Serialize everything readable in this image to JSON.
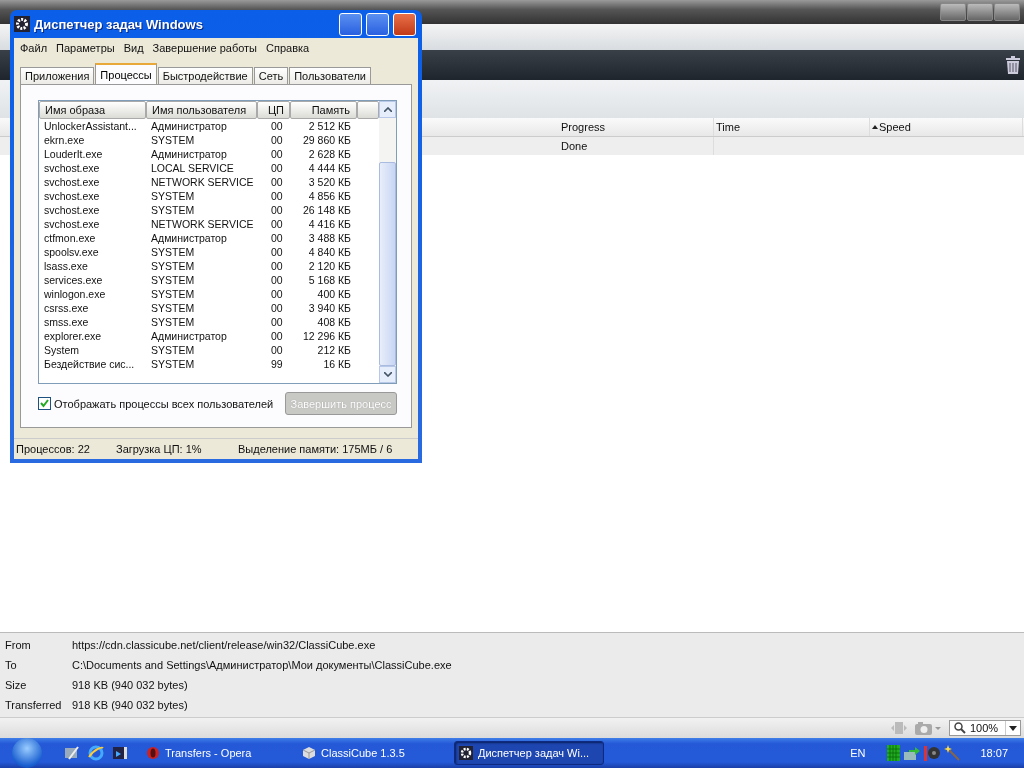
{
  "transfers": {
    "columns": [
      {
        "label": "Progress",
        "sorted": false
      },
      {
        "label": "Time",
        "sorted": false
      },
      {
        "label": "Speed",
        "sorted": true
      }
    ],
    "rows": [
      {
        "progress": "Done"
      }
    ]
  },
  "details": [
    {
      "label": "From",
      "value": "https://cdn.classicube.net/client/release/win32/ClassiCube.exe"
    },
    {
      "label": "To",
      "value": "C:\\Documents and Settings\\Администратор\\Мои документы\\ClassiCube.exe"
    },
    {
      "label": "Size",
      "value": "918 KB (940 032 bytes)"
    },
    {
      "label": "Transferred",
      "value": "918 KB (940 032 bytes)"
    }
  ],
  "zoom": "100%",
  "task_manager": {
    "title": "Диспетчер задач Windows",
    "menu": [
      "Файл",
      "Параметры",
      "Вид",
      "Завершение работы",
      "Справка"
    ],
    "tabs": [
      {
        "label": "Приложения",
        "selected": false
      },
      {
        "label": "Процессы",
        "selected": true
      },
      {
        "label": "Быстродействие",
        "selected": false
      },
      {
        "label": "Сеть",
        "selected": false
      },
      {
        "label": "Пользователи",
        "selected": false
      }
    ],
    "columns": [
      "Имя образа",
      "Имя пользователя",
      "ЦП",
      "Память"
    ],
    "processes": [
      {
        "name": "UnlockerAssistant...",
        "user": "Администратор",
        "cpu": "00",
        "memory": "2 512 КБ"
      },
      {
        "name": "ekrn.exe",
        "user": "SYSTEM",
        "cpu": "00",
        "memory": "29 860 КБ"
      },
      {
        "name": "LouderIt.exe",
        "user": "Администратор",
        "cpu": "00",
        "memory": "2 628 КБ"
      },
      {
        "name": "svchost.exe",
        "user": "LOCAL SERVICE",
        "cpu": "00",
        "memory": "4 444 КБ"
      },
      {
        "name": "svchost.exe",
        "user": "NETWORK SERVICE",
        "cpu": "00",
        "memory": "3 520 КБ"
      },
      {
        "name": "svchost.exe",
        "user": "SYSTEM",
        "cpu": "00",
        "memory": "4 856 КБ"
      },
      {
        "name": "svchost.exe",
        "user": "SYSTEM",
        "cpu": "00",
        "memory": "26 148 КБ"
      },
      {
        "name": "svchost.exe",
        "user": "NETWORK SERVICE",
        "cpu": "00",
        "memory": "4 416 КБ"
      },
      {
        "name": "ctfmon.exe",
        "user": "Администратор",
        "cpu": "00",
        "memory": "3 488 КБ"
      },
      {
        "name": "spoolsv.exe",
        "user": "SYSTEM",
        "cpu": "00",
        "memory": "4 840 КБ"
      },
      {
        "name": "lsass.exe",
        "user": "SYSTEM",
        "cpu": "00",
        "memory": "2 120 КБ"
      },
      {
        "name": "services.exe",
        "user": "SYSTEM",
        "cpu": "00",
        "memory": "5 168 КБ"
      },
      {
        "name": "winlogon.exe",
        "user": "SYSTEM",
        "cpu": "00",
        "memory": "400 КБ"
      },
      {
        "name": "csrss.exe",
        "user": "SYSTEM",
        "cpu": "00",
        "memory": "3 940 КБ"
      },
      {
        "name": "smss.exe",
        "user": "SYSTEM",
        "cpu": "00",
        "memory": "408 КБ"
      },
      {
        "name": "explorer.exe",
        "user": "Администратор",
        "cpu": "00",
        "memory": "12 296 КБ"
      },
      {
        "name": "System",
        "user": "SYSTEM",
        "cpu": "00",
        "memory": "212 КБ"
      },
      {
        "name": "Бездействие сис...",
        "user": "SYSTEM",
        "cpu": "99",
        "memory": "16 КБ"
      }
    ],
    "show_all_users": {
      "label": "Отображать процессы всех пользователей",
      "checked": true
    },
    "end_process_button": {
      "label": "Завершить процесс",
      "disabled": true
    },
    "status": [
      "Процессов: 22",
      "Загрузка ЦП: 1%",
      "Выделение памяти: 175МБ / 6"
    ]
  },
  "taskbar": {
    "tasks": [
      {
        "label": "Transfers - Opera",
        "selected": false
      },
      {
        "label": "ClassiCube 1.3.5",
        "selected": false
      },
      {
        "label": "Диспетчер задач Wi...",
        "selected": true
      }
    ],
    "language": "EN",
    "clock": "18:07"
  }
}
